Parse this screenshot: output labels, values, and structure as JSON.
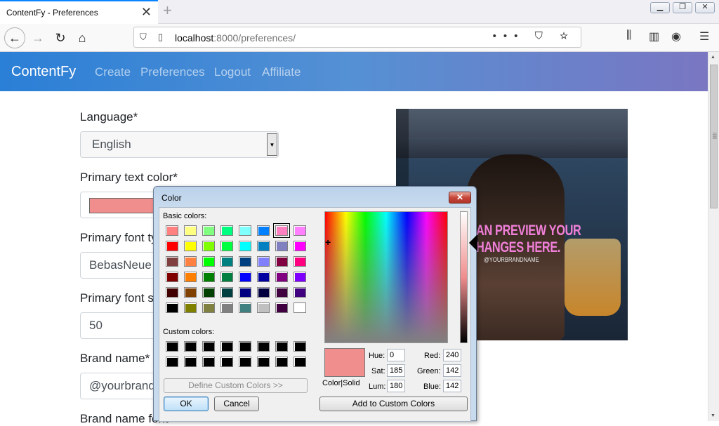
{
  "browser": {
    "tab_title": "ContentFy - Preferences",
    "tab_close": "✕",
    "new_tab": "+",
    "window_min": "▁",
    "window_max": "❐",
    "window_close": "✕",
    "url_host": "localhost",
    "url_rest": ":8000/preferences/",
    "url_actions": "••• ⛉ ☆"
  },
  "site": {
    "brand": "ContentFy",
    "nav": [
      "Create",
      "Preferences",
      "Logout",
      "Affiliate"
    ]
  },
  "form": {
    "language_label": "Language*",
    "language_value": "English",
    "primary_color_label": "Primary text color*",
    "primary_color_value": "#f08e8e",
    "font_type_label": "Primary font type*",
    "font_type_value": "BebasNeue",
    "font_size_label": "Primary font size*",
    "font_size_value": "50",
    "brand_name_label": "Brand name*",
    "brand_name_value": "@yourbrandname",
    "brand_font_label": "Brand name font*"
  },
  "preview": {
    "line1": "AN PREVIEW YOUR",
    "line2": "HANGES HERE.",
    "handle": "@YOURBRANDNAME"
  },
  "dialog": {
    "title": "Color",
    "close": "✕",
    "basic_colors_label": "Basic colors:",
    "custom_colors_label": "Custom colors:",
    "define_custom": "Define Custom Colors >>",
    "ok": "OK",
    "cancel": "Cancel",
    "color_solid": "Color|Solid",
    "hue_label": "Hue:",
    "sat_label": "Sat:",
    "lum_label": "Lum:",
    "red_label": "Red:",
    "green_label": "Green:",
    "blue_label": "Blue:",
    "hue": "0",
    "sat": "185",
    "lum": "180",
    "red": "240",
    "green": "142",
    "blue": "142",
    "add_custom": "Add to Custom Colors",
    "selected_color": "#f08e8e",
    "basic_colors": [
      [
        "#ff8080",
        "#ffff80",
        "#80ff80",
        "#00ff80",
        "#80ffff",
        "#0080ff",
        "#ff80c0",
        "#ff80ff"
      ],
      [
        "#ff0000",
        "#ffff00",
        "#80ff00",
        "#00ff40",
        "#00ffff",
        "#0080c0",
        "#8080c0",
        "#ff00ff"
      ],
      [
        "#804040",
        "#ff8040",
        "#00ff00",
        "#008080",
        "#004080",
        "#8080ff",
        "#800040",
        "#ff0080"
      ],
      [
        "#800000",
        "#ff8000",
        "#008000",
        "#008040",
        "#0000ff",
        "#0000a0",
        "#800080",
        "#8000ff"
      ],
      [
        "#400000",
        "#804000",
        "#004000",
        "#004040",
        "#000080",
        "#000040",
        "#400040",
        "#400080"
      ],
      [
        "#000000",
        "#808000",
        "#808040",
        "#808080",
        "#408080",
        "#c0c0c0",
        "#400040",
        "#ffffff"
      ]
    ],
    "selected_basic": [
      0,
      6
    ],
    "custom_colors": [
      [
        "#000000",
        "#000000",
        "#000000",
        "#000000",
        "#000000",
        "#000000",
        "#000000",
        "#000000"
      ],
      [
        "#000000",
        "#000000",
        "#000000",
        "#000000",
        "#000000",
        "#000000",
        "#000000",
        "#000000"
      ]
    ]
  }
}
